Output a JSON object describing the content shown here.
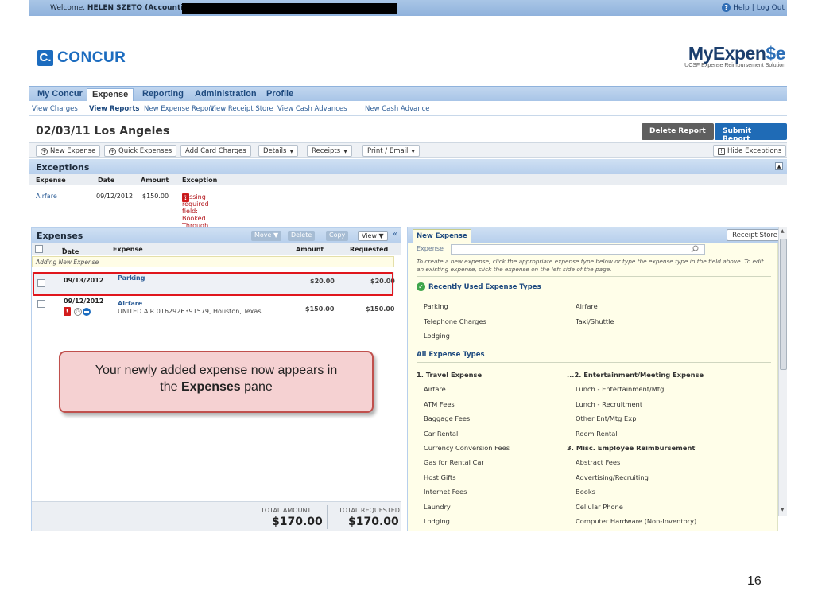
{
  "topbar": {
    "welcome_prefix": "Welcome,",
    "user": "HELEN SZETO (Accounting)",
    "help": "Help",
    "separator": "|",
    "logout": "Log Out"
  },
  "logos": {
    "concur_mark": "C.",
    "concur_word": "CONCUR",
    "myexp_a": "MyExpen",
    "myexp_b": "$e",
    "myexp_sub": "UCSF Expense Reimbursement Solution"
  },
  "mainnav": [
    "My Concur",
    "Expense",
    "Reporting",
    "Administration",
    "Profile"
  ],
  "subnav": [
    "View Charges",
    "View Reports",
    "New Expense Report",
    "View Receipt Store",
    "View Cash Advances",
    "New Cash Advance"
  ],
  "report": {
    "title": "02/03/11 Los Angeles",
    "delete_label": "Delete Report",
    "submit_label": "Submit Report"
  },
  "toolbar": {
    "new_expense": "New Expense",
    "quick_expenses": "Quick Expenses",
    "add_card": "Add Card Charges",
    "details": "Details",
    "receipts": "Receipts",
    "print": "Print / Email",
    "hide_exceptions": "Hide Exceptions"
  },
  "exceptions": {
    "title": "Exceptions",
    "columns": [
      "Expense",
      "Date",
      "Amount",
      "Exception"
    ],
    "row": {
      "expense": "Airfare",
      "date": "09/12/2012",
      "amount": "$150.00",
      "message": "Missing required field: Booked Through Connexxus?."
    }
  },
  "expenses": {
    "title": "Expenses",
    "move": "Move",
    "delete": "Delete",
    "copy": "Copy",
    "view": "View",
    "columns": {
      "date": "Date",
      "expense": "Expense",
      "amount": "Amount",
      "requested": "Requested"
    },
    "adding": "Adding New Expense",
    "rows": [
      {
        "date": "09/13/2012",
        "name": "Parking",
        "detail": "",
        "amount": "$20.00",
        "requested": "$20.00"
      },
      {
        "date": "09/12/2012",
        "name": "Airfare",
        "detail": "UNITED AIR 0162926391579, Houston, Texas",
        "amount": "$150.00",
        "requested": "$150.00"
      }
    ],
    "total_amount_label": "TOTAL AMOUNT",
    "total_amount": "$170.00",
    "total_requested_label": "TOTAL REQUESTED",
    "total_requested": "$170.00"
  },
  "callout": {
    "line1": "Your newly added expense now appears in",
    "pre": "the",
    "bold": "Expenses",
    "post": "pane"
  },
  "new_expense": {
    "tab": "New Expense",
    "receipt_store": "Receipt Store",
    "field_label": "Expense",
    "field_value": "",
    "help": "To create a new expense, click the appropriate expense type below or type the expense type in the field above. To edit an existing expense, click the expense on the left side of the page.",
    "recent_title": "Recently Used Expense Types",
    "recent_left": [
      "Parking",
      "Telephone Charges",
      "Lodging"
    ],
    "recent_right": [
      "Airfare",
      "Taxi/Shuttle"
    ],
    "all_title": "All Expense Types",
    "all_left": [
      "1. Travel Expense",
      "Airfare",
      "ATM Fees",
      "Baggage Fees",
      "Car Rental",
      "Currency Conversion Fees",
      "Gas for Rental Car",
      "Host Gifts",
      "Internet Fees",
      "Laundry",
      "Lodging"
    ],
    "all_right": [
      "...2. Entertainment/Meeting Expense",
      "Lunch - Entertainment/Mtg",
      "Lunch - Recruitment",
      "Other Ent/Mtg Exp",
      "Room Rental",
      "3. Misc. Employee Reimbursement",
      "Abstract Fees",
      "Advertising/Recruiting",
      "Books",
      "Cellular Phone",
      "Computer Hardware (Non-Inventory)"
    ]
  },
  "slide": {
    "page_number": "16"
  }
}
